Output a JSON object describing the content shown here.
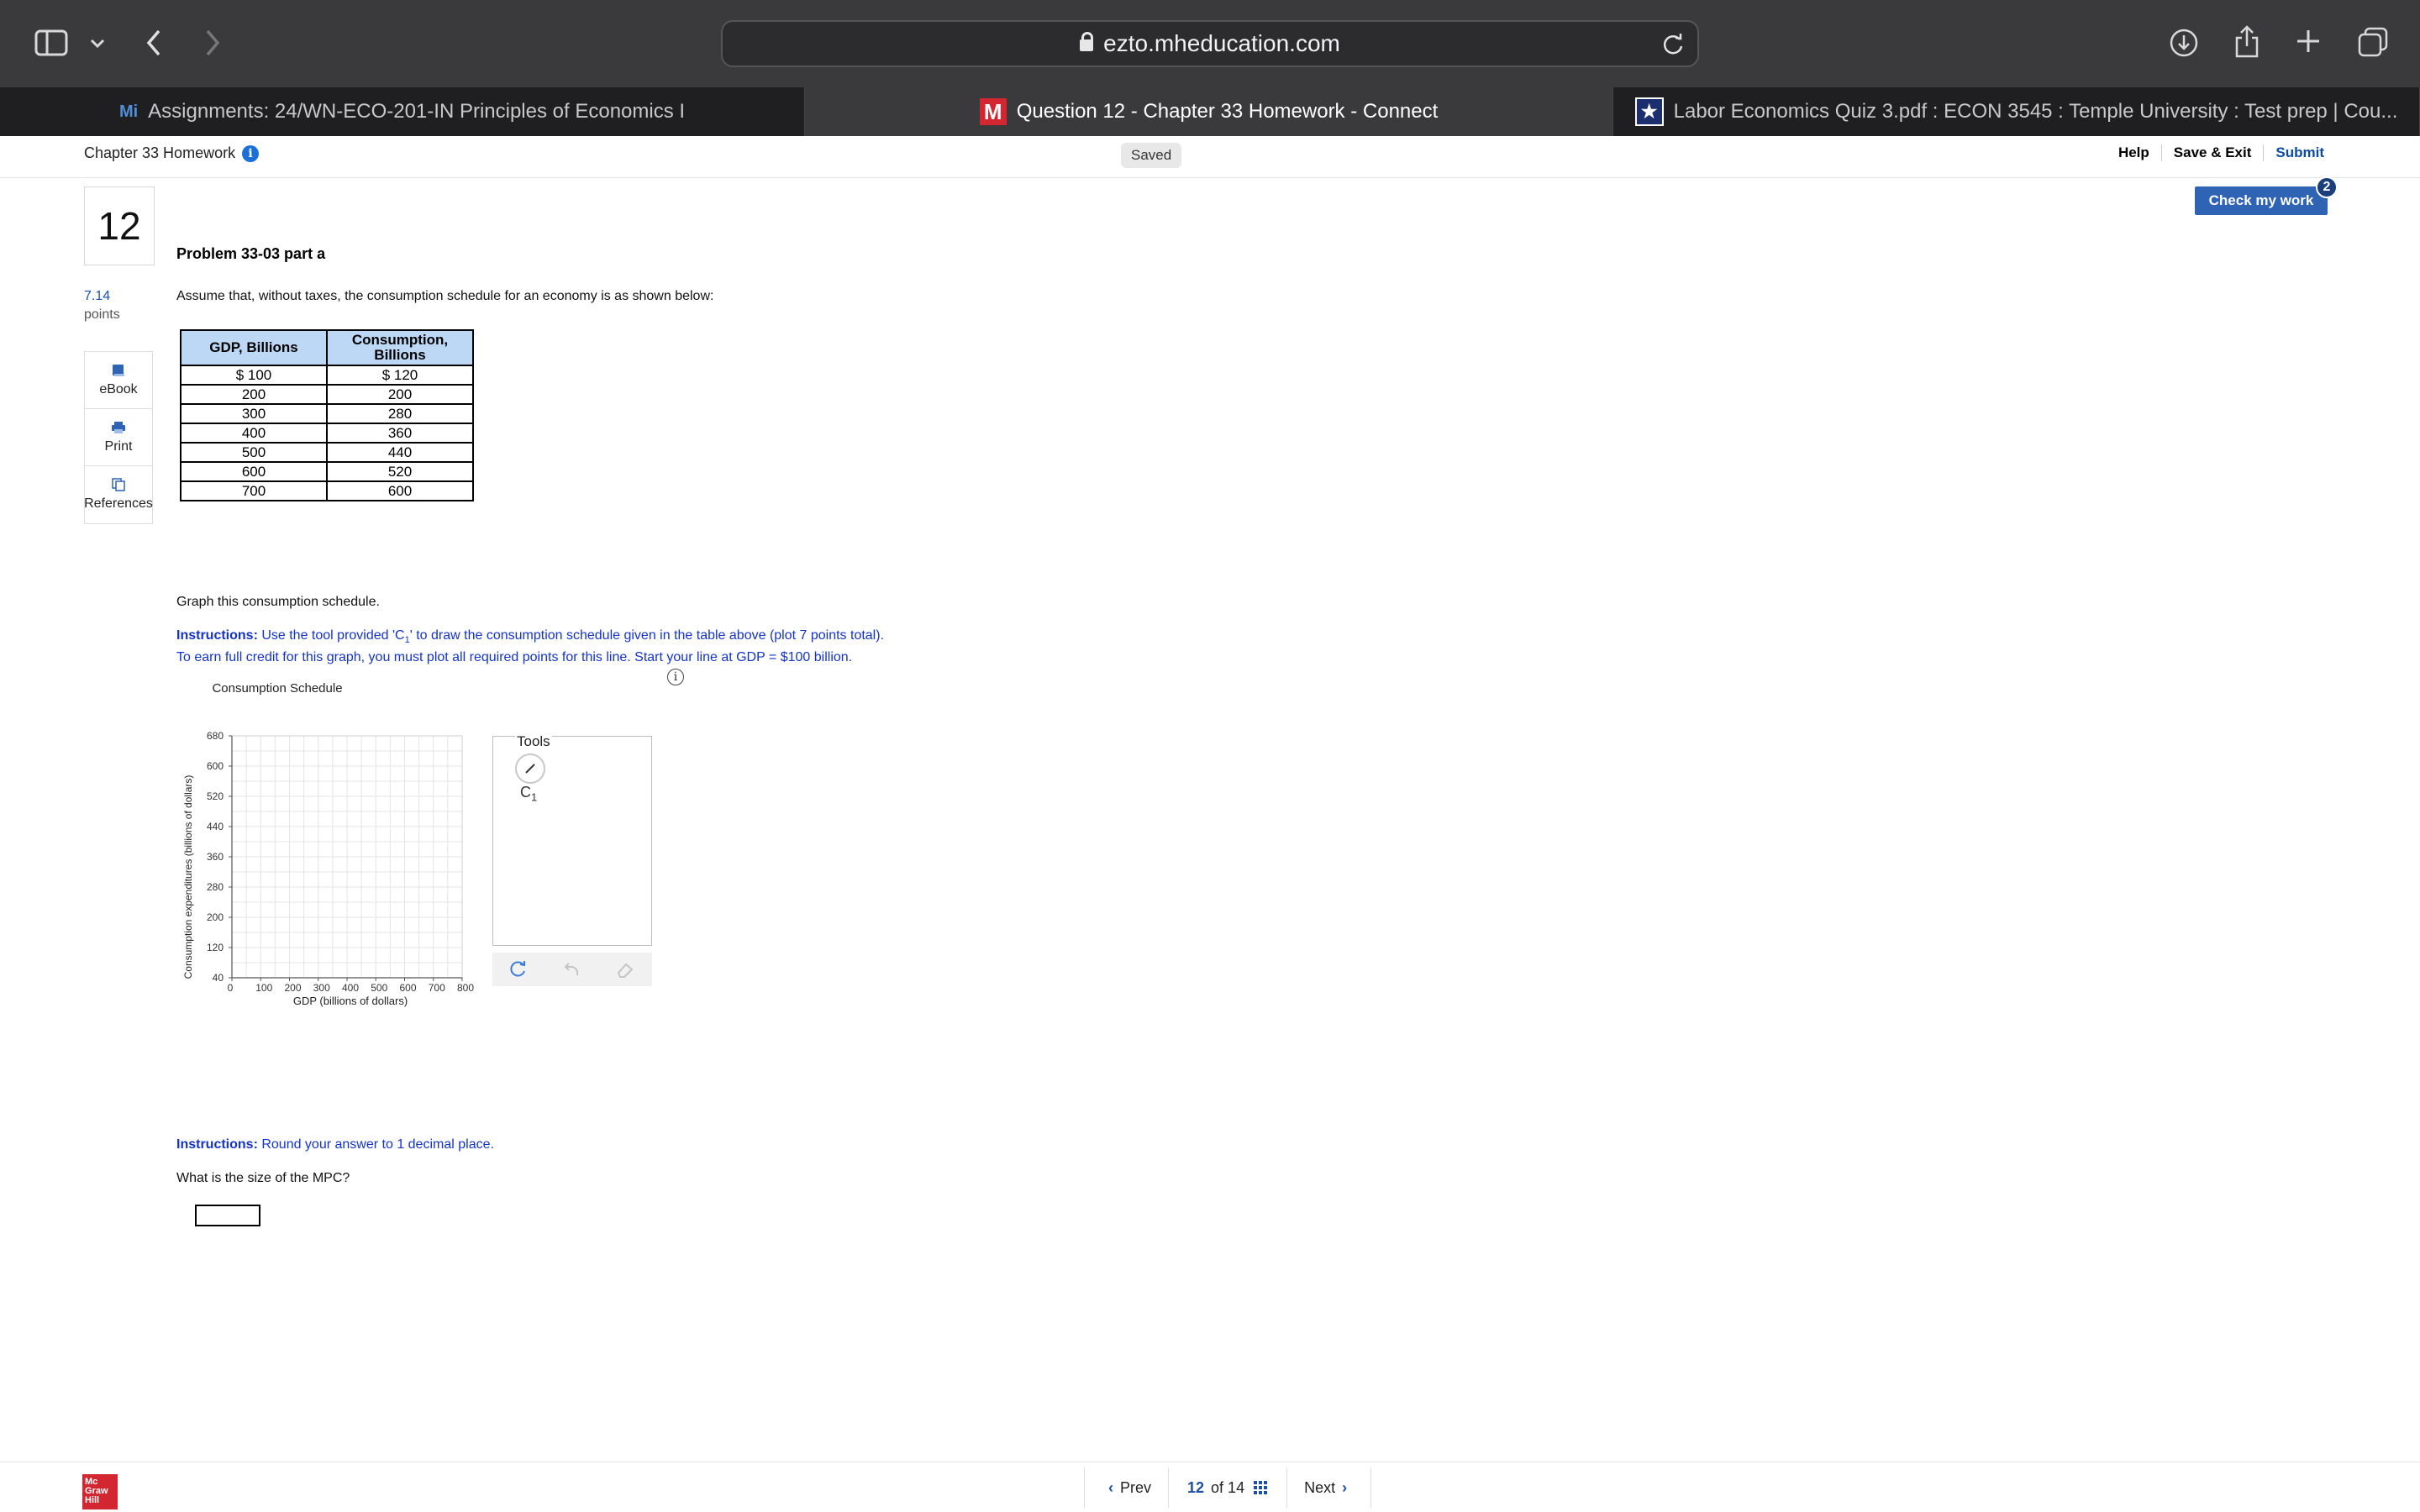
{
  "browser": {
    "url": "ezto.mheducation.com",
    "tabs": [
      {
        "icon": "Mi",
        "label": "Assignments: 24/WN-ECO-201-IN Principles of Economics I",
        "active": false
      },
      {
        "icon": "M",
        "label": "Question 12 - Chapter 33 Homework - Connect",
        "active": true
      },
      {
        "icon": "★",
        "label": "Labor Economics Quiz 3.pdf : ECON 3545 : Temple University : Test prep | Cou...",
        "active": false
      }
    ]
  },
  "header": {
    "title": "Chapter 33 Homework",
    "info_glyph": "i",
    "status": "Saved",
    "help": "Help",
    "save_exit": "Save & Exit",
    "submit": "Submit",
    "check_my_work": "Check my work",
    "check_badge": "2"
  },
  "question": {
    "number": "12",
    "points_value": "7.14",
    "points_label": "points",
    "title": "Problem 33-03 part a",
    "intro": "Assume that, without taxes, the consumption schedule for an economy is as shown below:",
    "graph_prompt": "Graph this consumption schedule.",
    "instructions_label": "Instructions:",
    "instructions_1a": " Use the tool provided 'C",
    "instructions_1sub": "1",
    "instructions_1b": "' to draw the consumption schedule given in the table above (plot 7 points total).",
    "instructions_2": "To earn full credit for this graph, you must plot all required points for this line. Start your line at GDP = $100 billion.",
    "instructions_3": " Round your answer to 1 decimal place.",
    "mpc_question": "What is the size of the MPC?",
    "answer_value": ""
  },
  "rail": [
    {
      "label": "eBook",
      "icon": "book-icon"
    },
    {
      "label": "Print",
      "icon": "printer-icon"
    },
    {
      "label": "References",
      "icon": "references-icon"
    }
  ],
  "table": {
    "headers": [
      "GDP, Billions",
      "Consumption, Billions"
    ],
    "rows": [
      [
        "$ 100",
        "$ 120"
      ],
      [
        "200",
        "200"
      ],
      [
        "300",
        "280"
      ],
      [
        "400",
        "360"
      ],
      [
        "500",
        "440"
      ],
      [
        "600",
        "520"
      ],
      [
        "700",
        "600"
      ]
    ]
  },
  "chart_data": {
    "type": "line",
    "title": "Consumption Schedule",
    "xlabel": "GDP (billions of dollars)",
    "ylabel": "Consumption expenditures (billions of dollars)",
    "xlim": [
      0,
      800
    ],
    "ylim": [
      40,
      680
    ],
    "xticks": [
      0,
      100,
      200,
      300,
      400,
      500,
      600,
      700,
      800
    ],
    "yticks": [
      40,
      120,
      200,
      280,
      360,
      440,
      520,
      600,
      680
    ],
    "grid": true,
    "series": []
  },
  "tools": {
    "title": "Tools",
    "tool_label": "C",
    "tool_sub": "1"
  },
  "footer": {
    "logo": "Mc Graw Hill",
    "prev": "Prev",
    "page_current": "12",
    "page_of": "of 14",
    "next": "Next"
  }
}
